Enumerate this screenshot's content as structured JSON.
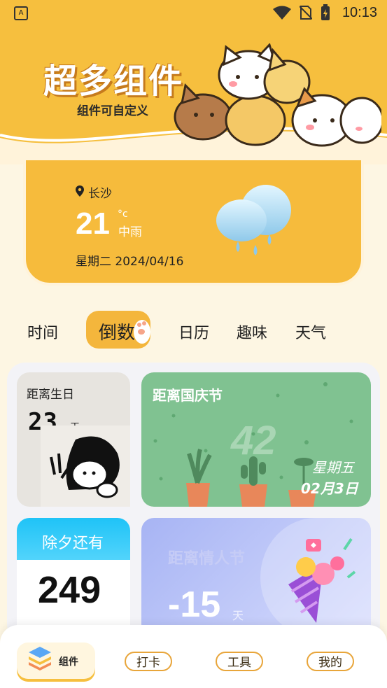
{
  "status_bar": {
    "time": "10:13"
  },
  "hero": {
    "title": "超多组件",
    "subtitle": "组件可自定义"
  },
  "weather": {
    "location": "长沙",
    "temperature": "21",
    "unit": "°c",
    "description": "中雨",
    "date": "星期二 2024/04/16"
  },
  "tabs": [
    {
      "label": "时间"
    },
    {
      "label": "倒数",
      "active": true
    },
    {
      "label": "日历"
    },
    {
      "label": "趣味"
    },
    {
      "label": "天气"
    }
  ],
  "cards": {
    "birthday": {
      "title": "距离生日",
      "number": "23",
      "unit": "天"
    },
    "national_day": {
      "title": "距离国庆节",
      "number": "42",
      "weekday": "星期五",
      "date": "02月3日"
    },
    "new_year_eve": {
      "title": "除夕还有",
      "number": "249"
    },
    "valentine": {
      "title": "距离情人节",
      "number": "-15",
      "unit": "天"
    }
  },
  "bottom_nav": {
    "items": [
      {
        "label": "组件",
        "active": true
      },
      {
        "label": "打卡"
      },
      {
        "label": "工具"
      },
      {
        "label": "我的"
      }
    ]
  },
  "colors": {
    "accent": "#f6bf3e",
    "green_card": "#80c291",
    "blue_header": "#27c6f5"
  }
}
